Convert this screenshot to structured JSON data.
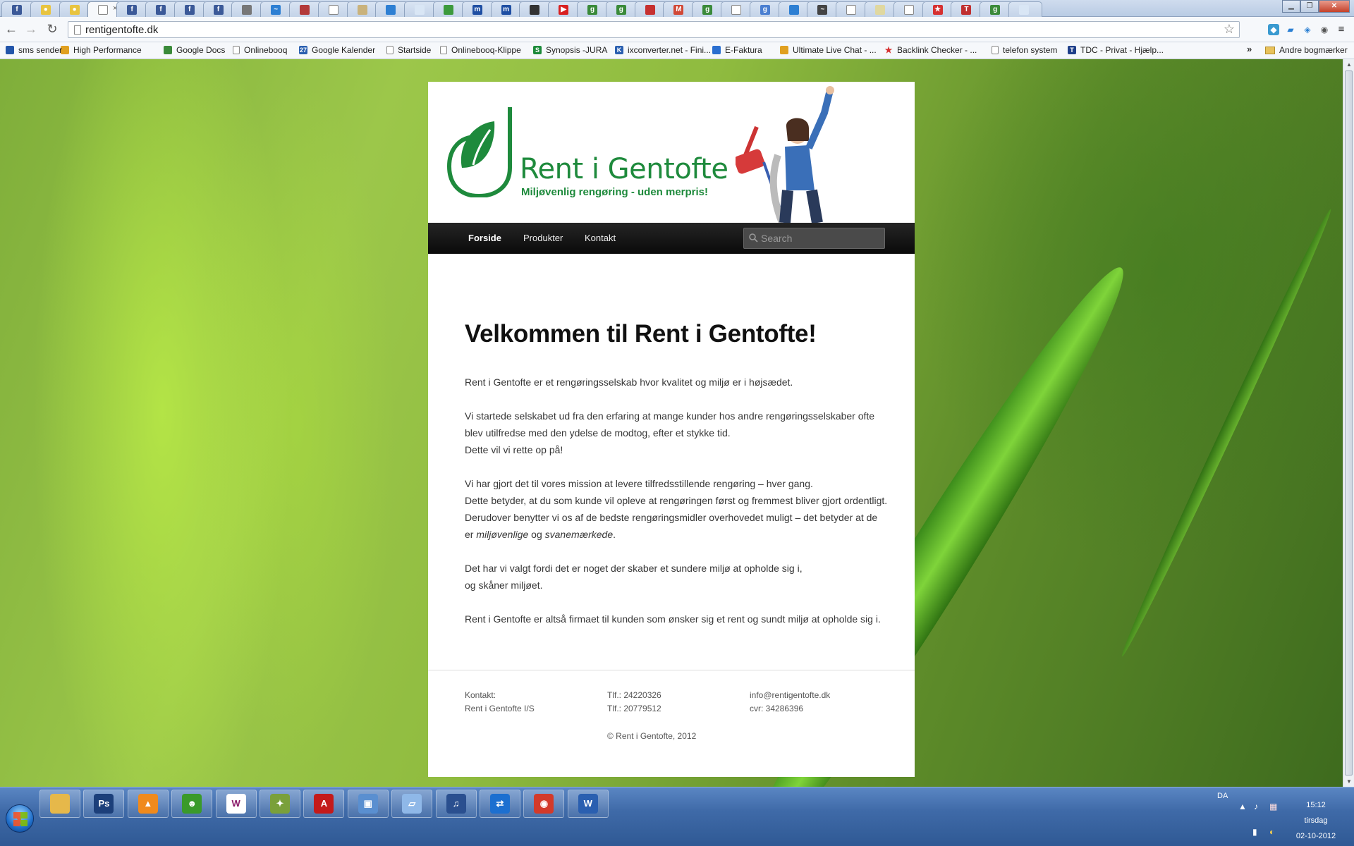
{
  "browser": {
    "tabs": [
      {
        "icon": "facebook-icon",
        "color": "#3b5998",
        "glyph": "f"
      },
      {
        "icon": "lightbulb-icon",
        "color": "#e8c440",
        "glyph": "●"
      },
      {
        "icon": "lightbulb-icon",
        "color": "#e8c440",
        "glyph": "●"
      },
      {
        "icon": "page-icon",
        "color": "#ffffff",
        "glyph": "",
        "active": true
      },
      {
        "icon": "facebook-icon",
        "color": "#3b5998",
        "glyph": "f"
      },
      {
        "icon": "facebook-icon",
        "color": "#3b5998",
        "glyph": "f"
      },
      {
        "icon": "facebook-icon",
        "color": "#3b5998",
        "glyph": "f"
      },
      {
        "icon": "facebook-icon",
        "color": "#3b5998",
        "glyph": "f"
      },
      {
        "icon": "site-icon",
        "color": "#777777",
        "glyph": ""
      },
      {
        "icon": "site-icon",
        "color": "#2d7fd3",
        "glyph": "~"
      },
      {
        "icon": "site-icon",
        "color": "#b33a3a",
        "glyph": ""
      },
      {
        "icon": "page-icon",
        "color": "#ffffff",
        "glyph": ""
      },
      {
        "icon": "site-icon",
        "color": "#c9b27c",
        "glyph": ""
      },
      {
        "icon": "site-icon",
        "color": "#2d7fd3",
        "glyph": ""
      },
      {
        "icon": "site-icon",
        "color": "#d9e6f5",
        "glyph": ""
      },
      {
        "icon": "site-icon",
        "color": "#3c9a3c",
        "glyph": ""
      },
      {
        "icon": "site-icon",
        "color": "#1f4fa3",
        "glyph": "m"
      },
      {
        "icon": "site-icon",
        "color": "#1f4fa3",
        "glyph": "m"
      },
      {
        "icon": "site-icon",
        "color": "#333333",
        "glyph": ""
      },
      {
        "icon": "youtube-icon",
        "color": "#d82020",
        "glyph": "▶"
      },
      {
        "icon": "google-icon",
        "color": "#3a8a3a",
        "glyph": "g"
      },
      {
        "icon": "google-icon",
        "color": "#3a8a3a",
        "glyph": "g"
      },
      {
        "icon": "site-icon",
        "color": "#c63030",
        "glyph": ""
      },
      {
        "icon": "gmail-icon",
        "color": "#d14836",
        "glyph": "M"
      },
      {
        "icon": "google-icon",
        "color": "#3a8a3a",
        "glyph": "g"
      },
      {
        "icon": "page-icon",
        "color": "#ffffff",
        "glyph": ""
      },
      {
        "icon": "google-icon",
        "color": "#4a7fd1",
        "glyph": "g"
      },
      {
        "icon": "site-icon",
        "color": "#2d7fd3",
        "glyph": ""
      },
      {
        "icon": "site-icon",
        "color": "#444444",
        "glyph": "~"
      },
      {
        "icon": "page-icon",
        "color": "#ffffff",
        "glyph": ""
      },
      {
        "icon": "site-icon",
        "color": "#e0d8a0",
        "glyph": ""
      },
      {
        "icon": "page-icon",
        "color": "#ffffff",
        "glyph": ""
      },
      {
        "icon": "star-icon",
        "color": "#d63030",
        "glyph": "★"
      },
      {
        "icon": "site-icon",
        "color": "#c03030",
        "glyph": "T"
      },
      {
        "icon": "google-icon",
        "color": "#3a8a3a",
        "glyph": "g"
      },
      {
        "icon": "site-icon",
        "color": "#d9e6f5",
        "glyph": ""
      }
    ],
    "url": "rentigentofte.dk",
    "bookmarks": [
      {
        "label": "sms sender",
        "icon": "site-icon",
        "color": "#2255aa"
      },
      {
        "label": "High Performance",
        "icon": "site-icon",
        "color": "#e0a020"
      },
      {
        "label": "Google Docs",
        "icon": "site-icon",
        "color": "#3a8a3a"
      },
      {
        "label": "Onlinebooq",
        "icon": "page-icon",
        "color": "#ffffff"
      },
      {
        "label": "Google Kalender",
        "icon": "calendar-icon",
        "color": "#2a5fb0",
        "glyph": "27"
      },
      {
        "label": "Startside",
        "icon": "page-icon",
        "color": "#ffffff"
      },
      {
        "label": "Onlinebooq-Klippe",
        "icon": "page-icon",
        "color": "#ffffff"
      },
      {
        "label": "Synopsis -JURA",
        "icon": "site-icon",
        "color": "#1c8a3a",
        "glyph": "S"
      },
      {
        "label": "ixconverter.net - Fini...",
        "icon": "site-icon",
        "color": "#2a5fb0",
        "glyph": "K"
      },
      {
        "label": "E-Faktura",
        "icon": "site-icon",
        "color": "#2a6fd0"
      },
      {
        "label": "Ultimate Live Chat - ...",
        "icon": "site-icon",
        "color": "#e0a020"
      },
      {
        "label": "Backlink Checker - ...",
        "icon": "star-icon",
        "color": "#d63030",
        "glyph": "★"
      },
      {
        "label": "telefon system",
        "icon": "page-icon",
        "color": "#ffffff"
      },
      {
        "label": "TDC - Privat - Hjælp...",
        "icon": "site-icon",
        "color": "#1f3f8a",
        "glyph": "T"
      }
    ],
    "other_bookmarks": "Andre bogmærker"
  },
  "site": {
    "logo_title": "Rent i Gentofte",
    "logo_tagline": "Miljøvenlig rengøring - uden merpris!",
    "brand_color": "#1e8a3c",
    "nav": [
      {
        "label": "Forside",
        "current": true
      },
      {
        "label": "Produkter",
        "current": false
      },
      {
        "label": "Kontakt",
        "current": false
      }
    ],
    "search_placeholder": "Search",
    "heading": "Velkommen til Rent i Gentofte!",
    "paragraphs": {
      "p1": "Rent i Gentofte er et rengøringsselskab hvor kvalitet og miljø er i højsædet.",
      "p2_l1": "Vi startede selskabet ud fra den erfaring at mange kunder hos andre rengøringsselskaber ofte blev utilfredse med den ydelse de modtog, efter et stykke tid.",
      "p2_l2": "Dette vil vi rette op på!",
      "p3_l1": "Vi har gjort det til vores mission at levere tilfredsstillende rengøring – hver gang.",
      "p3_l2_a": "Dette betyder, at du som kunde vil opleve at rengøringen først og fremmest bliver gjort ordentligt. Derudover benytter vi os af de bedste rengøringsmidler overhovedet muligt – det betyder at de er ",
      "p3_em1": "miljøvenlige",
      "p3_mid": " og ",
      "p3_em2": "svanemærkede",
      "p3_end": ".",
      "p4_l1": "Det har vi valgt fordi det er noget der skaber et sundere miljø at opholde sig i,",
      "p4_l2": "og skåner miljøet.",
      "p5": "Rent i Gentofte er altså firmaet til kunden som ønsker sig et rent og sundt miljø at opholde sig i."
    },
    "footer": {
      "col1_l1": "Kontakt:",
      "col1_l2": "Rent i Gentofte I/S",
      "col2_l1": "Tlf.: 24220326",
      "col2_l2": "Tlf.: 20779512",
      "col3_l1": "info@rentigentofte.dk",
      "col3_l2": "cvr: 34286396",
      "copyright": "© Rent i Gentofte, 2012"
    }
  },
  "taskbar": {
    "apps": [
      {
        "name": "explorer-icon",
        "color": "#e6b84a",
        "glyph": ""
      },
      {
        "name": "photoshop-icon",
        "color": "#1c3f7a",
        "glyph": "Ps"
      },
      {
        "name": "vlc-icon",
        "color": "#f08a1c",
        "glyph": "▲"
      },
      {
        "name": "frog-app-icon",
        "color": "#3a9a2a",
        "glyph": "☻"
      },
      {
        "name": "winamp-icon",
        "color": "#ffffff",
        "glyph": "W"
      },
      {
        "name": "bird-app-icon",
        "color": "#7aa03a",
        "glyph": "✦"
      },
      {
        "name": "acrobat-icon",
        "color": "#c41a1a",
        "glyph": "A"
      },
      {
        "name": "photo-viewer-icon",
        "color": "#5a8fd0",
        "glyph": "▣"
      },
      {
        "name": "notes-app-icon",
        "color": "#8fb8e8",
        "glyph": "▱"
      },
      {
        "name": "itunes-icon",
        "color": "#2a4f8f",
        "glyph": "♫"
      },
      {
        "name": "teamviewer-icon",
        "color": "#1c6fd0",
        "glyph": "⇄"
      },
      {
        "name": "chrome-icon",
        "color": "#d33a2a",
        "glyph": "◉"
      },
      {
        "name": "word-icon",
        "color": "#2a5fb0",
        "glyph": "W"
      }
    ],
    "language": "DA",
    "time": "15:12",
    "day": "tirsdag",
    "date": "02-10-2012"
  }
}
